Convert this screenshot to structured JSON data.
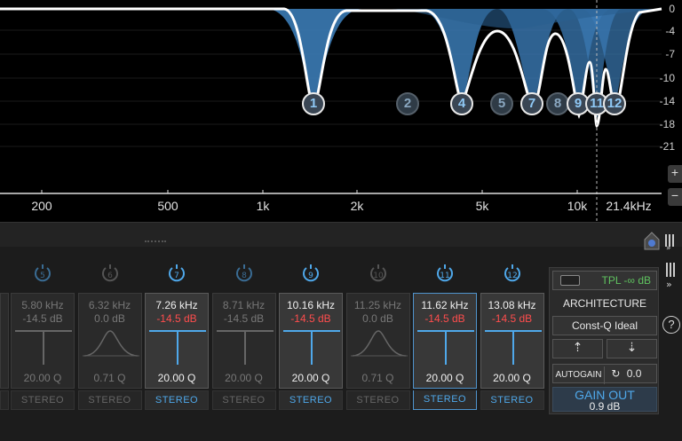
{
  "graph": {
    "db_labels": [
      "0",
      "-4",
      "-7",
      "-10",
      "-14",
      "-18",
      "-21"
    ],
    "freq_labels": [
      "200",
      "500",
      "1k",
      "2k",
      "5k",
      "10k",
      "21.4kHz"
    ],
    "nodes": [
      "1",
      "2",
      "4",
      "5",
      "7",
      "8",
      "9",
      "11",
      "12"
    ],
    "zoom_plus": "+",
    "zoom_minus": "−"
  },
  "bands": [
    {
      "num": "5",
      "freq": "5.80 kHz",
      "gain": "-14.5 dB",
      "q": "20.00 Q",
      "stereo": "STEREO",
      "active": false,
      "shape": "notch"
    },
    {
      "num": "6",
      "freq": "6.32 kHz",
      "gain": "0.0 dB",
      "q": "0.71 Q",
      "stereo": "STEREO",
      "active": false,
      "shape": "bell"
    },
    {
      "num": "7",
      "freq": "7.26 kHz",
      "gain": "-14.5 dB",
      "q": "20.00 Q",
      "stereo": "STEREO",
      "active": true,
      "shape": "notch"
    },
    {
      "num": "8",
      "freq": "8.71 kHz",
      "gain": "-14.5 dB",
      "q": "20.00 Q",
      "stereo": "STEREO",
      "active": false,
      "shape": "notch"
    },
    {
      "num": "9",
      "freq": "10.16 kHz",
      "gain": "-14.5 dB",
      "q": "20.00 Q",
      "stereo": "STEREO",
      "active": true,
      "shape": "notch"
    },
    {
      "num": "10",
      "freq": "11.25 kHz",
      "gain": "0.0 dB",
      "q": "0.71 Q",
      "stereo": "STEREO",
      "active": false,
      "shape": "bell"
    },
    {
      "num": "11",
      "freq": "11.62 kHz",
      "gain": "-14.5 dB",
      "q": "20.00 Q",
      "stereo": "STEREO",
      "active": true,
      "shape": "notch",
      "selected": true
    },
    {
      "num": "12",
      "freq": "13.08 kHz",
      "gain": "-14.5 dB",
      "q": "20.00 Q",
      "stereo": "STEREO",
      "active": true,
      "shape": "notch"
    }
  ],
  "controls": {
    "tpl": "TPL -∞ dB",
    "architecture": "ARCHITECTURE",
    "mode": "Const-Q Ideal",
    "autogain": "AUTOGAIN",
    "autogain_value": "0.0 dB",
    "gain_out_label": "GAIN OUT",
    "gain_out_value": "0.9 dB",
    "help": "?"
  },
  "colors": {
    "accent": "#4fa8ea",
    "fill": "#3b7bb5",
    "gain_red": "#ff4d4d"
  }
}
